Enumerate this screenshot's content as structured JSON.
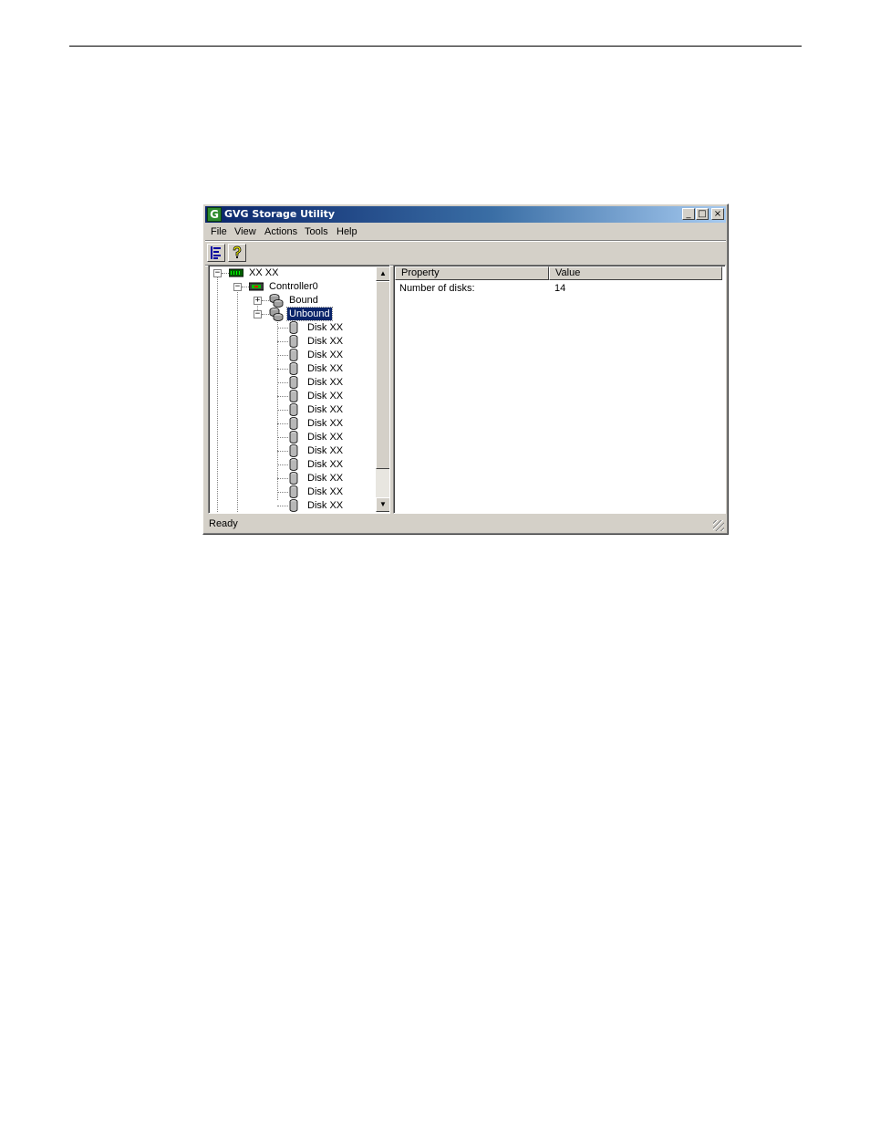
{
  "window": {
    "title": "GVG Storage Utility",
    "icon": "gvg-logo-icon",
    "icon_letter": "G",
    "controls": {
      "minimize": "_",
      "maximize": "□",
      "close": "×"
    }
  },
  "menu": [
    {
      "label": "File"
    },
    {
      "label": "View"
    },
    {
      "label": "Actions"
    },
    {
      "label": "Tools"
    },
    {
      "label": "Help"
    }
  ],
  "toolbar": [
    {
      "icon": "tree-view-icon"
    },
    {
      "icon": "help-icon"
    }
  ],
  "tree": {
    "root": {
      "label": "XX XX",
      "icon": "chassis-icon",
      "expanded": true
    },
    "controller": {
      "label": "Controller0",
      "icon": "controller-icon",
      "expanded": true
    },
    "bound": {
      "label": "Bound",
      "icon": "disk-group-icon",
      "expanded": false
    },
    "unbound": {
      "label": "Unbound",
      "icon": "disk-group-icon",
      "expanded": true,
      "selected": true
    },
    "disks": [
      "Disk XX",
      "Disk XX",
      "Disk XX",
      "Disk XX",
      "Disk XX",
      "Disk XX",
      "Disk XX",
      "Disk XX",
      "Disk XX",
      "Disk XX",
      "Disk XX",
      "Disk XX",
      "Disk XX",
      "Disk XX"
    ]
  },
  "list": {
    "columns": [
      "Property",
      "Value"
    ],
    "rows": [
      {
        "property": "Number of disks:",
        "value": "14"
      }
    ]
  },
  "status": {
    "text": "Ready"
  },
  "colors": {
    "selection": "#0a246a",
    "face": "#d4d0c8",
    "title_start": "#0a246a",
    "title_end": "#a6caf0"
  }
}
